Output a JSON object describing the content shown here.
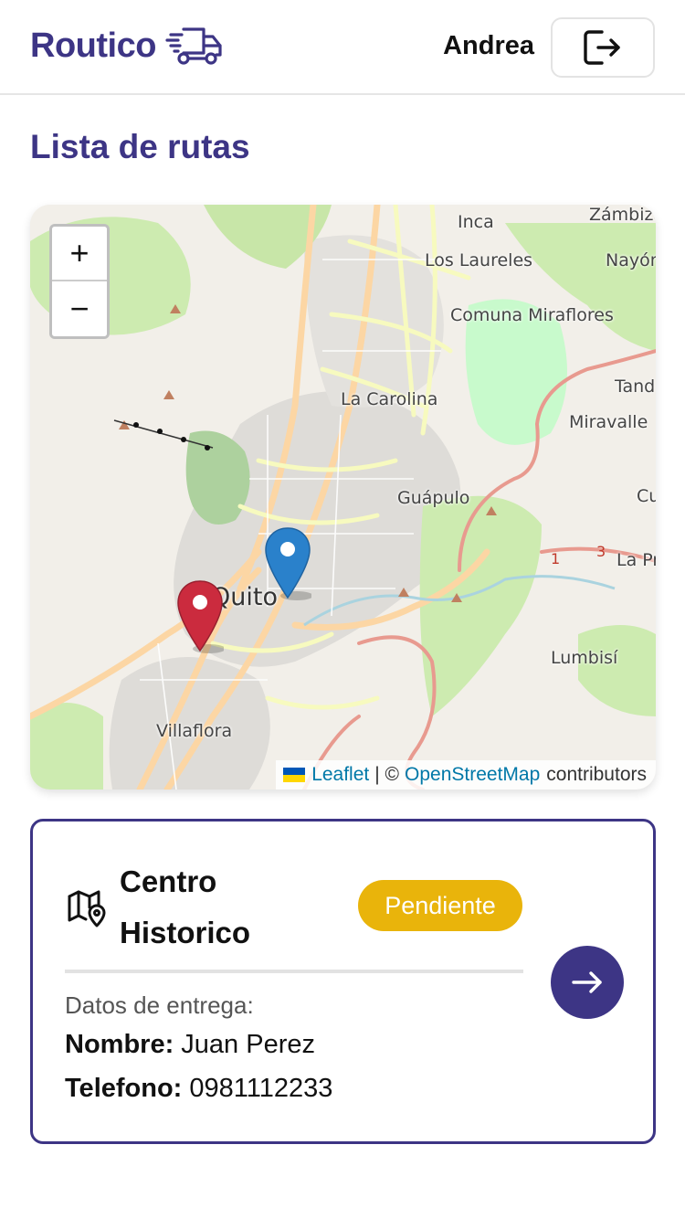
{
  "app": {
    "brand": "Routico",
    "user_name": "Andrea"
  },
  "icons": {
    "brand": "delivery-truck-icon",
    "logout": "logout-icon",
    "map": "map-pin-icon",
    "arrow": "arrow-right-icon"
  },
  "colors": {
    "brand": "#3d3585",
    "badge_pending": "#e9b40b",
    "marker_blue": "#2a81cb",
    "marker_red": "#cb2b3e"
  },
  "page": {
    "title": "Lista de rutas"
  },
  "map": {
    "zoom_in": "+",
    "zoom_out": "−",
    "labels": {
      "inca": "Inca",
      "zambiza": "Zámbiza",
      "los_laureles": "Los Laureles",
      "nayon": "Nayón",
      "miraflores": "Comuna Miraflores",
      "la_carolina": "La Carolina",
      "tanda": "Tand",
      "miravalle": "Miravalle",
      "guapulo": "Guápulo",
      "cu": "Cu",
      "la_pr": "La Pr",
      "quito": "Quito",
      "lumbisi": "Lumbisí",
      "villaflora": "Villaflora"
    },
    "attribution": {
      "leaflet": "Leaflet",
      "separator": "| ©",
      "osm": "OpenStreetMap",
      "contributors": "contributors"
    }
  },
  "route": {
    "title": "Centro Historico",
    "status": "Pendiente",
    "delivery_heading": "Datos de entrega:",
    "name_label": "Nombre:",
    "name_value": "Juan Perez",
    "phone_label": "Telefono:",
    "phone_value": "0981112233"
  }
}
